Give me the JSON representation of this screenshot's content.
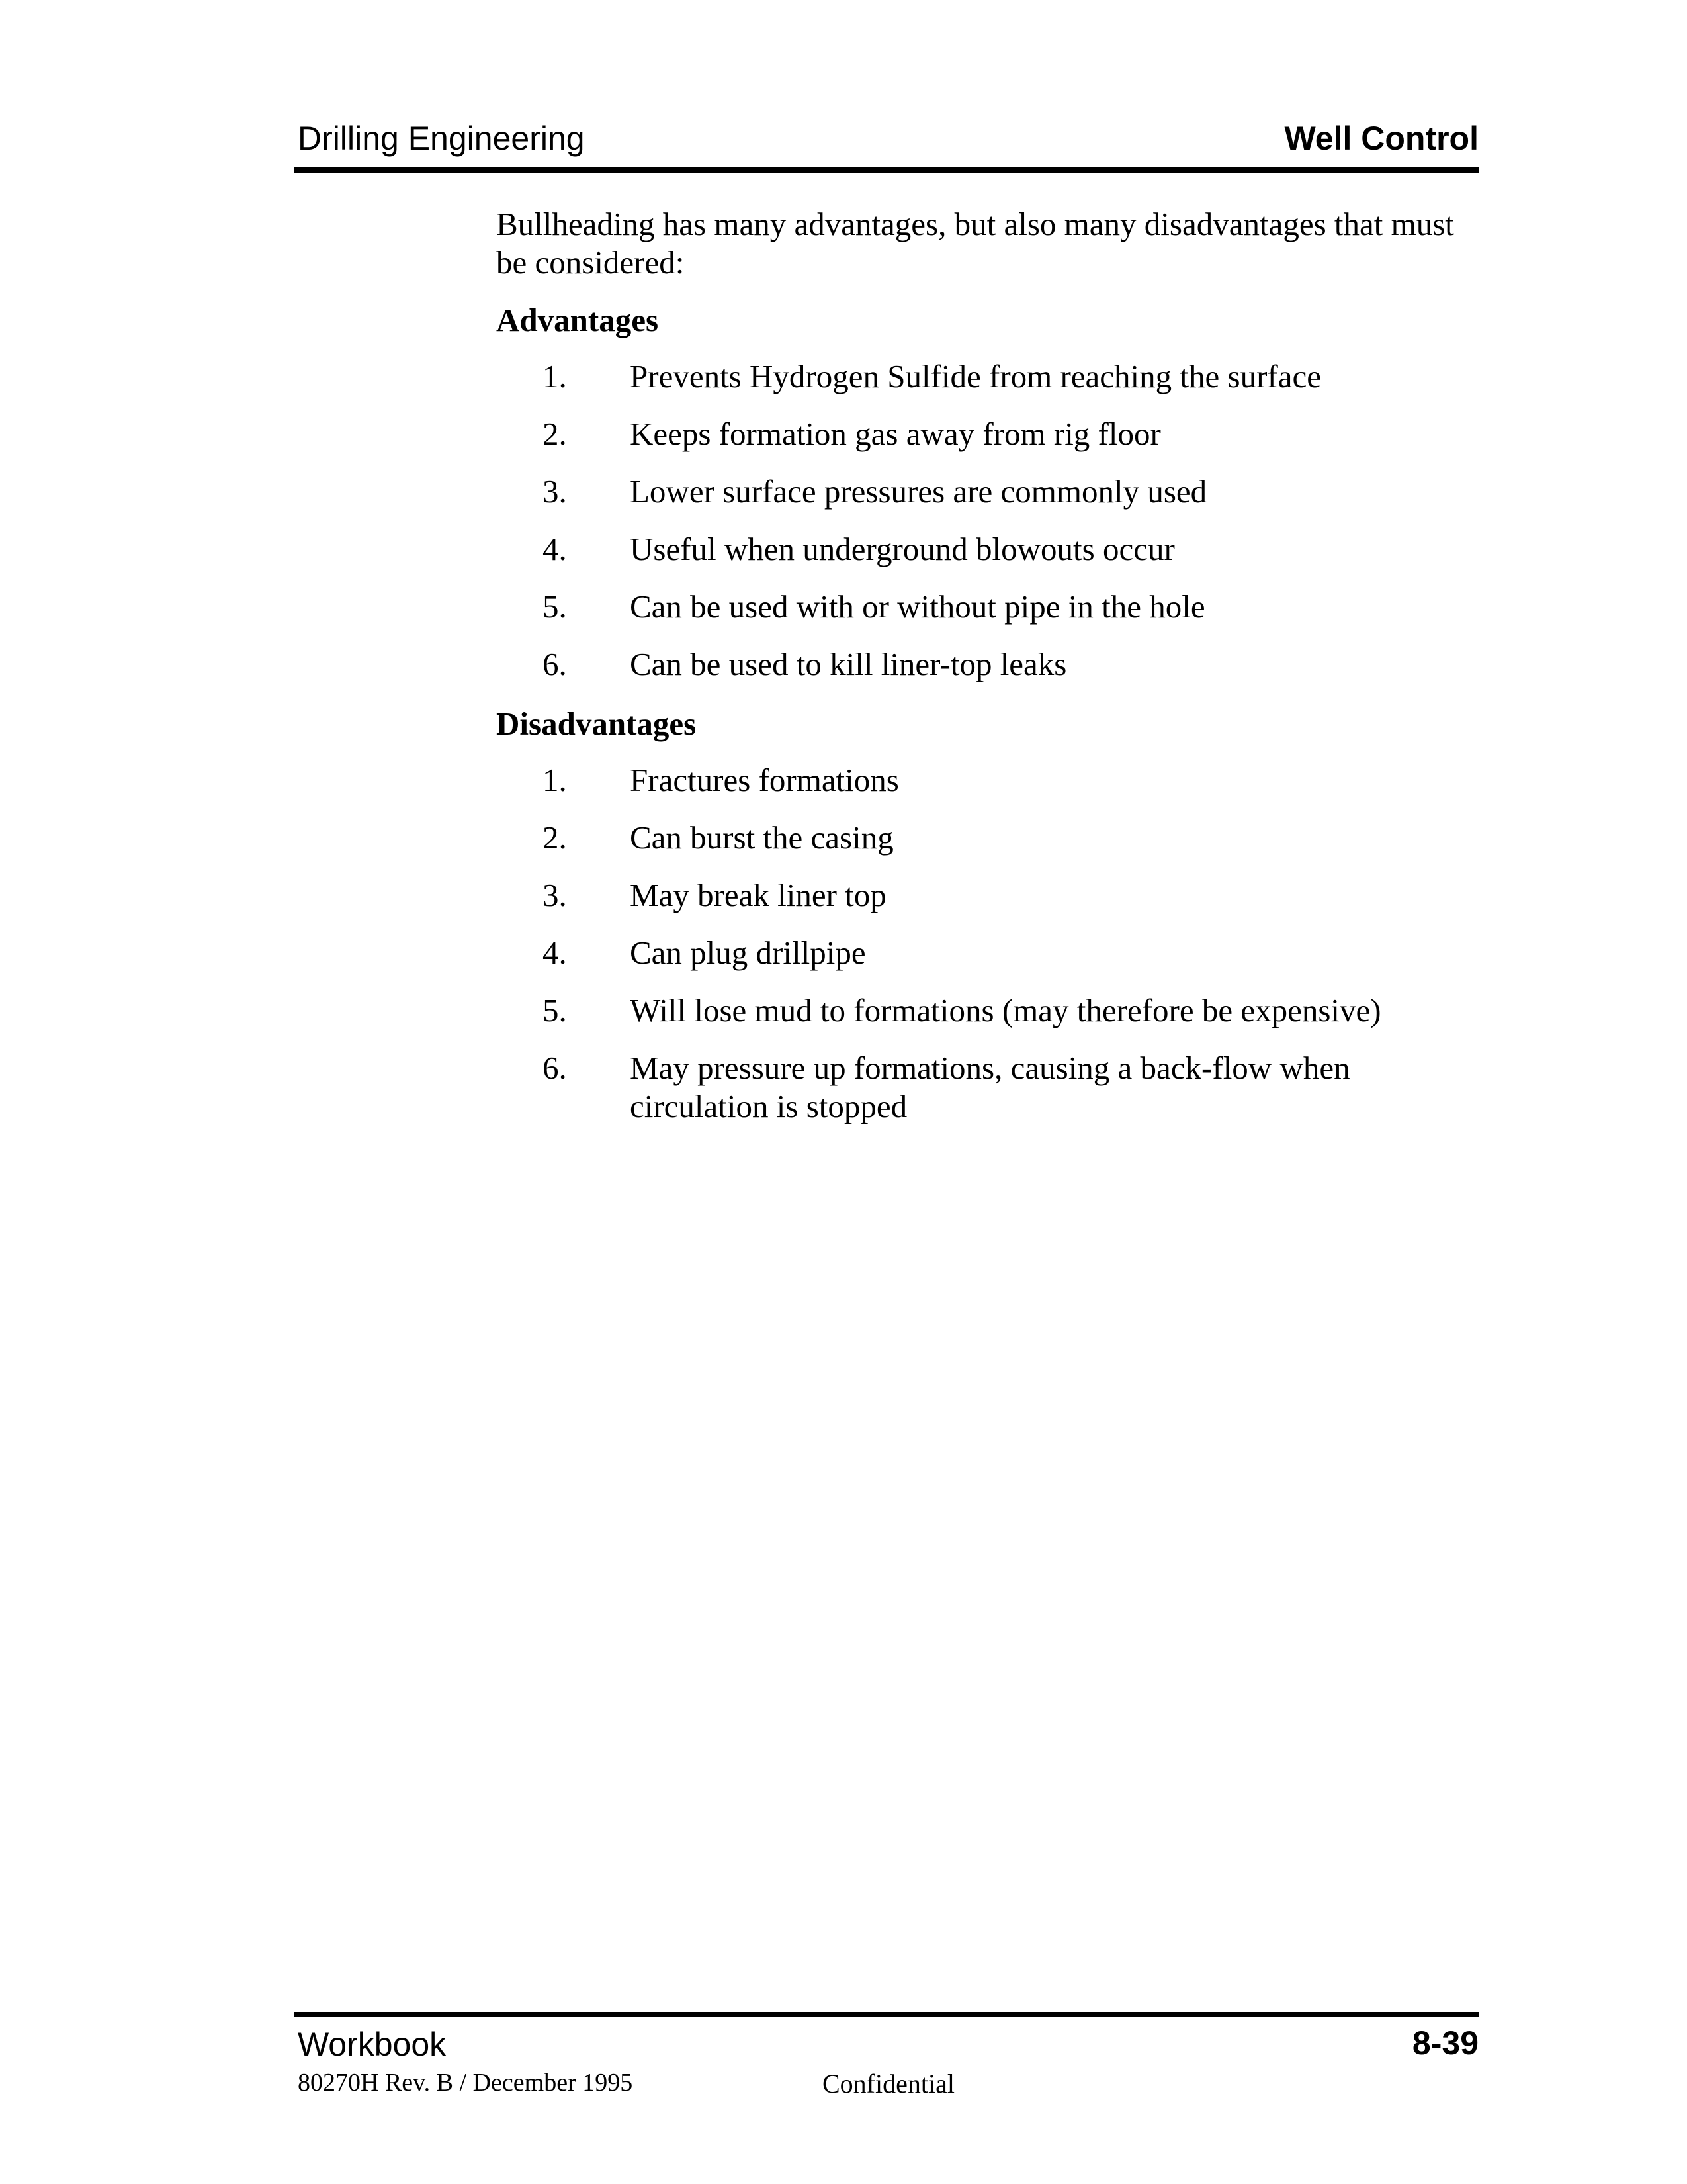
{
  "header": {
    "left_title": "Drilling Engineering",
    "right_title": "Well Control"
  },
  "intro": "Bullheading has many advantages, but also many disadvantages that must be considered:",
  "advantages": {
    "heading": "Advantages",
    "items": [
      {
        "num": "1.",
        "text": "Prevents Hydrogen Sulfide from reaching the surface"
      },
      {
        "num": "2.",
        "text": "Keeps formation gas away from rig floor"
      },
      {
        "num": "3.",
        "text": "Lower surface pressures are commonly used"
      },
      {
        "num": "4.",
        "text": "Useful when underground blowouts occur"
      },
      {
        "num": "5.",
        "text": "Can be used with or without pipe in the hole"
      },
      {
        "num": "6.",
        "text": "Can be used to kill liner-top leaks"
      }
    ]
  },
  "disadvantages": {
    "heading": "Disadvantages",
    "items": [
      {
        "num": "1.",
        "text": "Fractures formations"
      },
      {
        "num": "2.",
        "text": "Can burst the casing"
      },
      {
        "num": "3.",
        "text": "May break liner top"
      },
      {
        "num": "4.",
        "text": "Can plug drillpipe"
      },
      {
        "num": "5.",
        "text": "Will lose mud to formations (may therefore be expensive)"
      },
      {
        "num": "6.",
        "text": "May pressure up formations, causing a back-flow when circulation is stopped"
      }
    ]
  },
  "footer": {
    "left_title": "Workbook",
    "revision": "80270H Rev. B / December 1995",
    "center": "Confidential",
    "page_number": "8-39"
  }
}
